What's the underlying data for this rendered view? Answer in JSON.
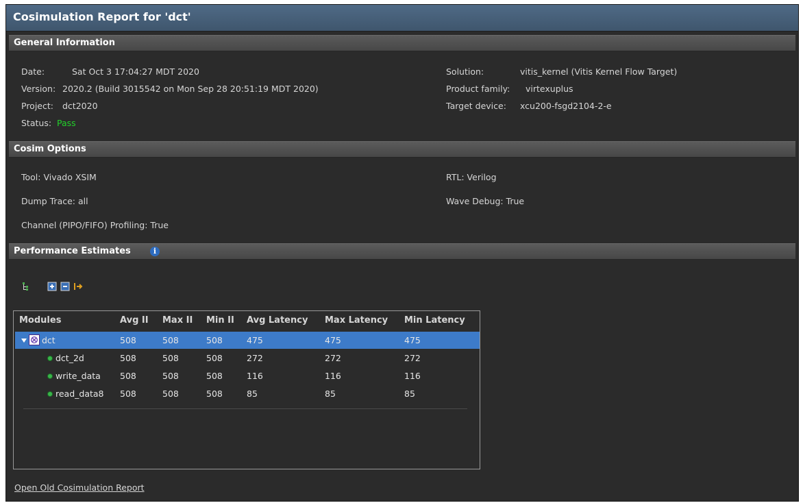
{
  "title": "Cosimulation Report for 'dct'",
  "general": {
    "header": "General Information",
    "date_label": "Date:",
    "date": "Sat Oct 3 17:04:27 MDT 2020",
    "version_label": "Version:",
    "version": "2020.2 (Build 3015542 on Mon Sep 28 20:51:19 MDT 2020)",
    "project_label": "Project:",
    "project": "dct2020",
    "status_label": "Status:",
    "status": "Pass",
    "solution_label": "Solution:",
    "solution": "vitis_kernel (Vitis Kernel Flow Target)",
    "family_label": "Product family:",
    "family": "virtexuplus",
    "device_label": "Target device:",
    "device": "xcu200-fsgd2104-2-e"
  },
  "cosim": {
    "header": "Cosim Options",
    "tool": "Tool: Vivado XSIM",
    "dump": "Dump Trace: all",
    "channel": "Channel (PIPO/FIFO) Profiling: True",
    "rtl": "RTL: Verilog",
    "wave": "Wave Debug: True"
  },
  "perf": {
    "header": "Performance Estimates",
    "info_glyph": "i",
    "columns": [
      "Modules",
      "Avg II",
      "Max II",
      "Min II",
      "Avg Latency",
      "Max Latency",
      "Min Latency"
    ],
    "rows": [
      {
        "name": "dct",
        "avg_ii": "508",
        "max_ii": "508",
        "min_ii": "508",
        "avg_lat": "475",
        "max_lat": "475",
        "min_lat": "475"
      },
      {
        "name": "dct_2d",
        "avg_ii": "508",
        "max_ii": "508",
        "min_ii": "508",
        "avg_lat": "272",
        "max_lat": "272",
        "min_lat": "272"
      },
      {
        "name": "write_data",
        "avg_ii": "508",
        "max_ii": "508",
        "min_ii": "508",
        "avg_lat": "116",
        "max_lat": "116",
        "min_lat": "116"
      },
      {
        "name": "read_data8",
        "avg_ii": "508",
        "max_ii": "508",
        "min_ii": "508",
        "avg_lat": "85",
        "max_lat": "85",
        "min_lat": "85"
      }
    ]
  },
  "link_text": "Open Old Cosimulation Report",
  "colors": {
    "title_bg": "#46607a",
    "selected_row": "#3d7bc9",
    "pass": "#22d12a",
    "panel_bg": "#2b2b2b"
  }
}
